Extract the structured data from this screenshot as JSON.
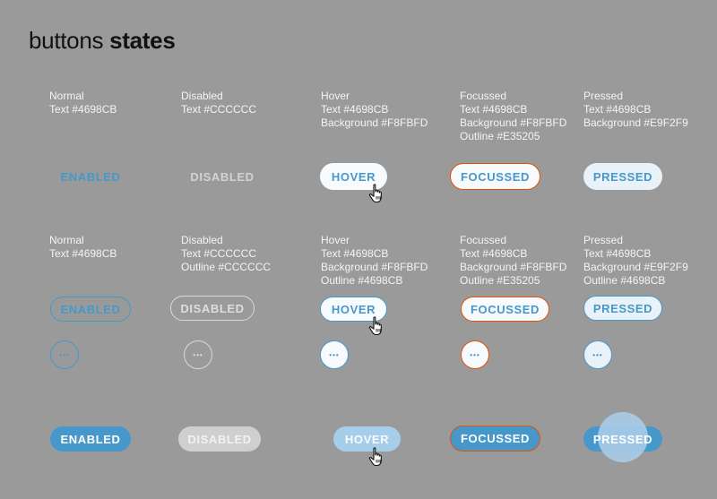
{
  "title": {
    "light": "buttons",
    "bold": "states"
  },
  "colors": {
    "text_blue": "#4698CB",
    "disabled": "#CCCCCC",
    "hover_bg": "#F8FBFD",
    "focus_outline": "#E35205",
    "pressed_bg": "#E9F2F9"
  },
  "row1": {
    "captions": [
      "Normal\nText #4698CB",
      "Disabled\nText #CCCCCC",
      "Hover\nText #4698CB\nBackground #F8FBFD",
      "Focussed\nText #4698CB\nBackground #F8FBFD\nOutline #E35205",
      "Pressed\nText #4698CB\nBackground #E9F2F9"
    ],
    "buttons": [
      "ENABLED",
      "DISABLED",
      "HOVER",
      "FOCUSSED",
      "PRESSED"
    ]
  },
  "row2": {
    "captions": [
      "Normal\nText #4698CB",
      "Disabled\nText #CCCCCC\nOutline #CCCCCC",
      "Hover\nText #4698CB\nBackground #F8FBFD\nOutline #4698CB",
      "Focussed\nText #4698CB\nBackground #F8FBFD\nOutline #E35205",
      "Pressed\nText #4698CB\nBackground #E9F2F9\nOutline #4698CB"
    ],
    "buttons": [
      "ENABLED",
      "DISABLED",
      "HOVER",
      "FOCUSSED",
      "PRESSED"
    ],
    "icon_glyph": "•••"
  },
  "row3": {
    "buttons": [
      "ENABLED",
      "DISABLED",
      "HOVER",
      "FOCUSSED",
      "PRESSED"
    ]
  },
  "icons": {
    "cursor": "hand-pointer-icon",
    "more": "more-dots-icon"
  }
}
